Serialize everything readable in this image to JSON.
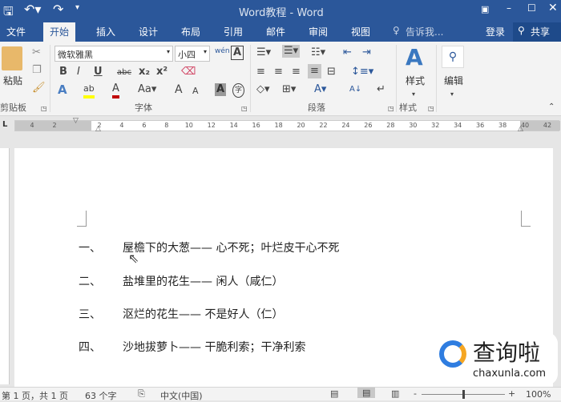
{
  "window": {
    "title": "Word教程 - Word"
  },
  "qat": {
    "save": "save-icon",
    "undo": "undo-icon",
    "redo": "redo-icon"
  },
  "tabs": [
    {
      "label": "文件"
    },
    {
      "label": "开始"
    },
    {
      "label": "插入"
    },
    {
      "label": "设计"
    },
    {
      "label": "布局"
    },
    {
      "label": "引用"
    },
    {
      "label": "邮件"
    },
    {
      "label": "审阅"
    },
    {
      "label": "视图"
    }
  ],
  "tell_me": "告诉我...",
  "signin": "登录",
  "share": "共享",
  "ribbon": {
    "paste": "粘贴",
    "font_name": "微软雅黑",
    "font_size": "小四",
    "phonetic": "wén",
    "styles": "样式",
    "edit": "编辑",
    "groups": {
      "clipboard": "剪贴板",
      "font": "字体",
      "paragraph": "段落",
      "styles": "样式"
    }
  },
  "ruler": {
    "left": [
      "4",
      "2"
    ],
    "right": [
      "2",
      "4",
      "6",
      "8",
      "10",
      "12",
      "14",
      "16",
      "18",
      "20",
      "22",
      "24",
      "26",
      "28",
      "30",
      "32",
      "34",
      "36",
      "38",
      "40",
      "42"
    ]
  },
  "document": {
    "items": [
      {
        "num": "一、",
        "text": "屋檐下的大葱—— 心不死；叶烂皮干心不死"
      },
      {
        "num": "二、",
        "text": "盐堆里的花生—— 闲人（咸仁）"
      },
      {
        "num": "三、",
        "text": "沤烂的花生—— 不是好人（仁）"
      },
      {
        "num": "四、",
        "text": "沙地拔萝卜—— 干脆利索；干净利索"
      }
    ]
  },
  "status": {
    "page": "第 1 页，共 1 页",
    "words": "63 个字",
    "language": "中文(中国)",
    "zoom": "100%",
    "zoom_value": 100
  },
  "watermark": {
    "text": "查询啦",
    "url": "chaxunla.com"
  },
  "colors": {
    "brand": "#2b579a",
    "highlight": "#ffff00",
    "font_color": "#c00000"
  }
}
